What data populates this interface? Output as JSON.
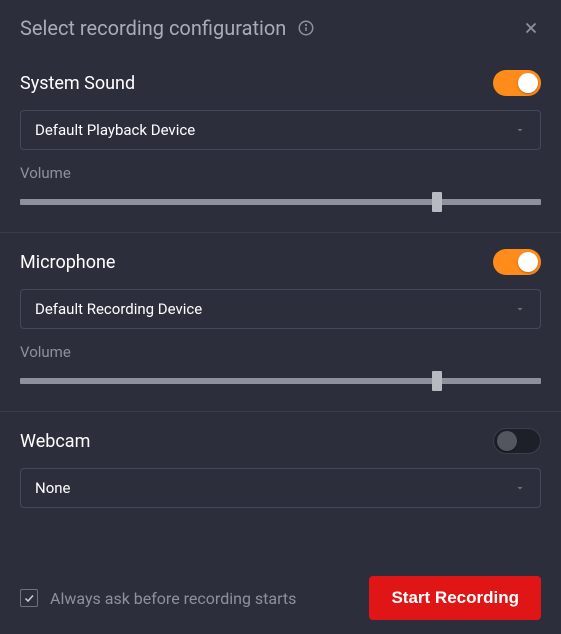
{
  "header": {
    "title": "Select recording configuration"
  },
  "system_sound": {
    "title": "System Sound",
    "toggle": true,
    "device": "Default Playback Device",
    "volume_label": "Volume",
    "volume_percent": 80
  },
  "microphone": {
    "title": "Microphone",
    "toggle": true,
    "device": "Default Recording Device",
    "volume_label": "Volume",
    "volume_percent": 80
  },
  "webcam": {
    "title": "Webcam",
    "toggle": false,
    "device": "None"
  },
  "footer": {
    "ask_checked": true,
    "ask_label": "Always ask before recording starts",
    "start_label": "Start Recording"
  }
}
